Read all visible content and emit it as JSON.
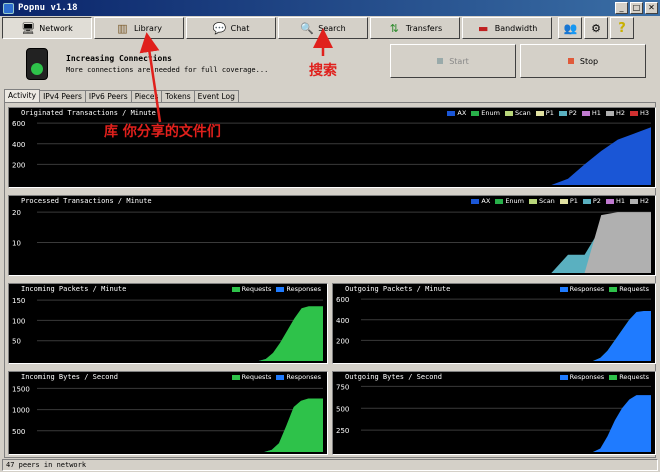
{
  "window": {
    "title": "Popnu v1.18",
    "min": "_",
    "max": "□",
    "close": "✕"
  },
  "toolbar": {
    "network": "Network",
    "library": "Library",
    "chat": "Chat",
    "search": "Search",
    "transfers": "Transfers",
    "bandwidth": "Bandwidth",
    "help": "?"
  },
  "status": {
    "title": "Increasing Connections",
    "subtitle": "More connections are needed for full coverage...",
    "start": "Start",
    "stop": "Stop"
  },
  "tabs": [
    "Activity",
    "IPv4 Peers",
    "IPv6 Peers",
    "Pieces",
    "Tokens",
    "Event Log"
  ],
  "annotations": {
    "library": "库 你分享的文件们",
    "search": "搜索"
  },
  "statusbar": "47 peers in network",
  "colors": {
    "AX": "#1a56d6",
    "Enum": "#28b04a",
    "Scan": "#b8d67a",
    "P1": "#e0e0a0",
    "P2": "#5ab0c0",
    "H1": "#c07ad0",
    "H2": "#b0b0b0",
    "H3": "#d03030",
    "Requests": "#2ec24a",
    "Responses": "#1f7bff"
  },
  "chart_data": [
    {
      "type": "area",
      "title": "Originated Transactions / Minute",
      "legend": [
        "AX",
        "Enum",
        "Scan",
        "P1",
        "P2",
        "H1",
        "H2",
        "H3"
      ],
      "yticks": [
        600,
        400,
        200
      ],
      "ylim": [
        0,
        650
      ],
      "series": [
        {
          "name": "AX",
          "values": [
            0,
            0,
            0,
            0,
            0,
            0,
            0,
            0,
            0,
            0,
            0,
            0,
            0,
            0,
            0,
            0,
            0,
            0,
            0,
            0,
            0,
            0,
            0,
            0,
            0,
            0,
            0,
            0,
            0,
            0,
            0,
            0,
            60,
            200,
            330,
            440,
            500,
            560
          ]
        }
      ]
    },
    {
      "type": "area",
      "title": "Processed Transactions / Minute",
      "legend": [
        "AX",
        "Enum",
        "Scan",
        "P1",
        "P2",
        "H1",
        "H2"
      ],
      "yticks": [
        20,
        10
      ],
      "ylim": [
        0,
        22
      ],
      "series": [
        {
          "name": "AX",
          "values": [
            0,
            0,
            0,
            0,
            0,
            0,
            0,
            0,
            0,
            0,
            0,
            0,
            0,
            0,
            0,
            0,
            0,
            0,
            0,
            0,
            0,
            0,
            0,
            0,
            0,
            0,
            0,
            0,
            0,
            0,
            0,
            0,
            4,
            4,
            5,
            6,
            6,
            6
          ]
        },
        {
          "name": "P2",
          "values": [
            0,
            0,
            0,
            0,
            0,
            0,
            0,
            0,
            0,
            0,
            0,
            0,
            0,
            0,
            0,
            0,
            0,
            0,
            0,
            0,
            0,
            0,
            0,
            0,
            0,
            0,
            0,
            0,
            0,
            0,
            0,
            0,
            6,
            6,
            15,
            15,
            14,
            14
          ]
        },
        {
          "name": "H2",
          "values": [
            0,
            0,
            0,
            0,
            0,
            0,
            0,
            0,
            0,
            0,
            0,
            0,
            0,
            0,
            0,
            0,
            0,
            0,
            0,
            0,
            0,
            0,
            0,
            0,
            0,
            0,
            0,
            0,
            0,
            0,
            0,
            0,
            0,
            0,
            19,
            20,
            20,
            20
          ]
        }
      ]
    },
    {
      "type": "area",
      "title": "Incoming Packets / Minute",
      "legend": [
        "Requests",
        "Responses"
      ],
      "yticks": [
        150,
        100,
        50
      ],
      "ylim": [
        0,
        165
      ],
      "series": [
        {
          "name": "Responses",
          "values": [
            0,
            0,
            0,
            0,
            0,
            0,
            0,
            0,
            0,
            0,
            0,
            0,
            0,
            0,
            0,
            0,
            0,
            0,
            0,
            0,
            0,
            0,
            0,
            0,
            0,
            0,
            0,
            0,
            0,
            0,
            0,
            0,
            5,
            18,
            40,
            65,
            90,
            115,
            120,
            120,
            120
          ]
        },
        {
          "name": "Requests",
          "values": [
            0,
            0,
            0,
            0,
            0,
            0,
            0,
            0,
            0,
            0,
            0,
            0,
            0,
            0,
            0,
            0,
            0,
            0,
            0,
            0,
            0,
            0,
            0,
            0,
            0,
            0,
            0,
            0,
            0,
            0,
            0,
            0,
            5,
            20,
            45,
            75,
            105,
            130,
            135,
            135,
            135
          ]
        }
      ]
    },
    {
      "type": "area",
      "title": "Outgoing Packets / Minute",
      "legend": [
        "Responses",
        "Requests"
      ],
      "yticks": [
        600,
        400,
        200
      ],
      "ylim": [
        0,
        650
      ],
      "series": [
        {
          "name": "Requests",
          "values": [
            0,
            0,
            0,
            0,
            0,
            0,
            0,
            0,
            0,
            0,
            0,
            0,
            0,
            0,
            0,
            0,
            0,
            0,
            0,
            0,
            0,
            0,
            0,
            0,
            0,
            0,
            0,
            0,
            0,
            0,
            0,
            0,
            0,
            30,
            100,
            200,
            300,
            400,
            470,
            480,
            480
          ]
        },
        {
          "name": "Responses",
          "values": [
            0,
            0,
            0,
            0,
            0,
            0,
            0,
            0,
            0,
            0,
            0,
            0,
            0,
            0,
            0,
            0,
            0,
            0,
            0,
            0,
            0,
            0,
            0,
            0,
            0,
            0,
            0,
            0,
            0,
            0,
            0,
            0,
            0,
            30,
            100,
            200,
            300,
            400,
            475,
            485,
            485
          ]
        }
      ]
    },
    {
      "type": "area",
      "title": "Incoming Bytes / Second",
      "legend": [
        "Requests",
        "Responses"
      ],
      "yticks": [
        1500,
        1000,
        500
      ],
      "ylim": [
        0,
        1650
      ],
      "series": [
        {
          "name": "Responses",
          "values": [
            0,
            0,
            0,
            0,
            0,
            0,
            0,
            0,
            0,
            0,
            0,
            0,
            0,
            0,
            0,
            0,
            0,
            0,
            0,
            0,
            0,
            0,
            0,
            0,
            0,
            0,
            0,
            0,
            0,
            0,
            0,
            0,
            50,
            200,
            600,
            1050,
            1200,
            1250,
            1250,
            1250
          ]
        },
        {
          "name": "Requests",
          "values": [
            0,
            0,
            0,
            0,
            0,
            0,
            0,
            0,
            0,
            0,
            0,
            0,
            0,
            0,
            0,
            0,
            0,
            0,
            0,
            0,
            0,
            0,
            0,
            0,
            0,
            0,
            0,
            0,
            0,
            0,
            0,
            0,
            50,
            210,
            620,
            1060,
            1210,
            1260,
            1260,
            1260
          ]
        }
      ]
    },
    {
      "type": "area",
      "title": "Outgoing Bytes / Second",
      "legend": [
        "Responses",
        "Requests"
      ],
      "yticks": [
        750,
        500,
        250
      ],
      "ylim": [
        0,
        800
      ],
      "series": [
        {
          "name": "Requests",
          "values": [
            0,
            0,
            0,
            0,
            0,
            0,
            0,
            0,
            0,
            0,
            0,
            0,
            0,
            0,
            0,
            0,
            0,
            0,
            0,
            0,
            0,
            0,
            0,
            0,
            0,
            0,
            0,
            0,
            0,
            0,
            0,
            0,
            0,
            30,
            120,
            220,
            300,
            360,
            380,
            380,
            380
          ]
        },
        {
          "name": "Responses",
          "values": [
            0,
            0,
            0,
            0,
            0,
            0,
            0,
            0,
            0,
            0,
            0,
            0,
            0,
            0,
            0,
            0,
            0,
            0,
            0,
            0,
            0,
            0,
            0,
            0,
            0,
            0,
            0,
            0,
            0,
            0,
            0,
            0,
            0,
            40,
            180,
            360,
            500,
            600,
            650,
            650,
            650
          ]
        }
      ]
    }
  ]
}
